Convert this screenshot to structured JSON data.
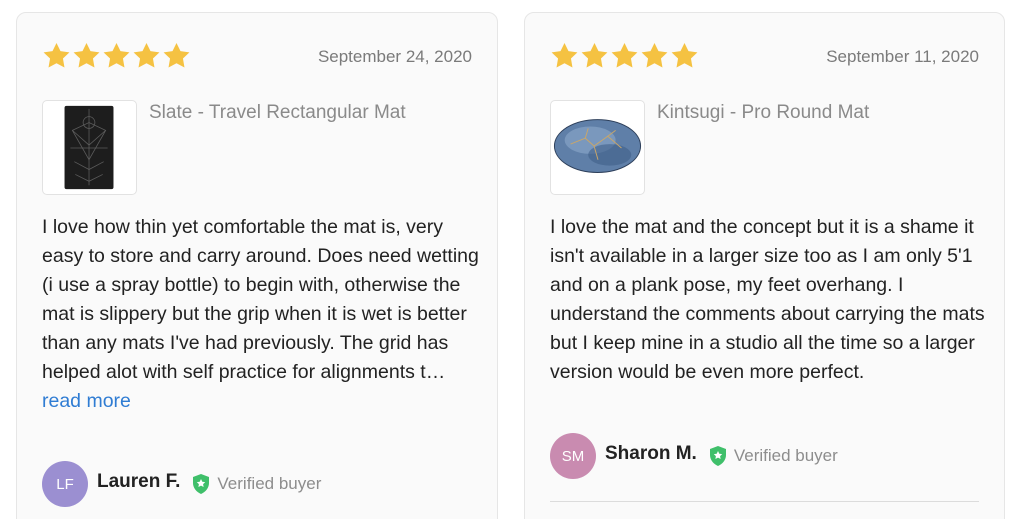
{
  "colors": {
    "star": "#f5c242",
    "link": "#2f7cd3",
    "verified_badge": "#3fbf6a"
  },
  "reviews": [
    {
      "rating": 5,
      "date": "September 24, 2020",
      "product": "Slate - Travel Rectangular Mat",
      "thumbnail_icon": "black-rectangular-yoga-mat",
      "body": "I love how thin yet comfortable the mat is, very easy to store and carry around. Does need wetting (i use a spray bottle) to begin with, otherwise the mat is slippery but the grip when it is wet is better than any mats I've had previously. The grid has helped alot with self practice for alignments t…",
      "read_more": "read more",
      "author": {
        "initials": "LF",
        "name": "Lauren F.",
        "avatar_color": "#9b8fd1"
      },
      "verified_label": "Verified buyer"
    },
    {
      "rating": 5,
      "date": "September 11, 2020",
      "product": "Kintsugi - Pro Round Mat",
      "thumbnail_icon": "blue-round-yoga-mat",
      "body": "I love the mat and the concept but it is a shame it isn't available in a larger size too as I am only 5'1 and on a plank pose, my feet overhang. I understand the comments about carrying the mats but I keep mine in a studio all the time so a larger version would be even more perfect.",
      "author": {
        "initials": "SM",
        "name": "Sharon M.",
        "avatar_color": "#c98bb0"
      },
      "verified_label": "Verified buyer"
    }
  ]
}
